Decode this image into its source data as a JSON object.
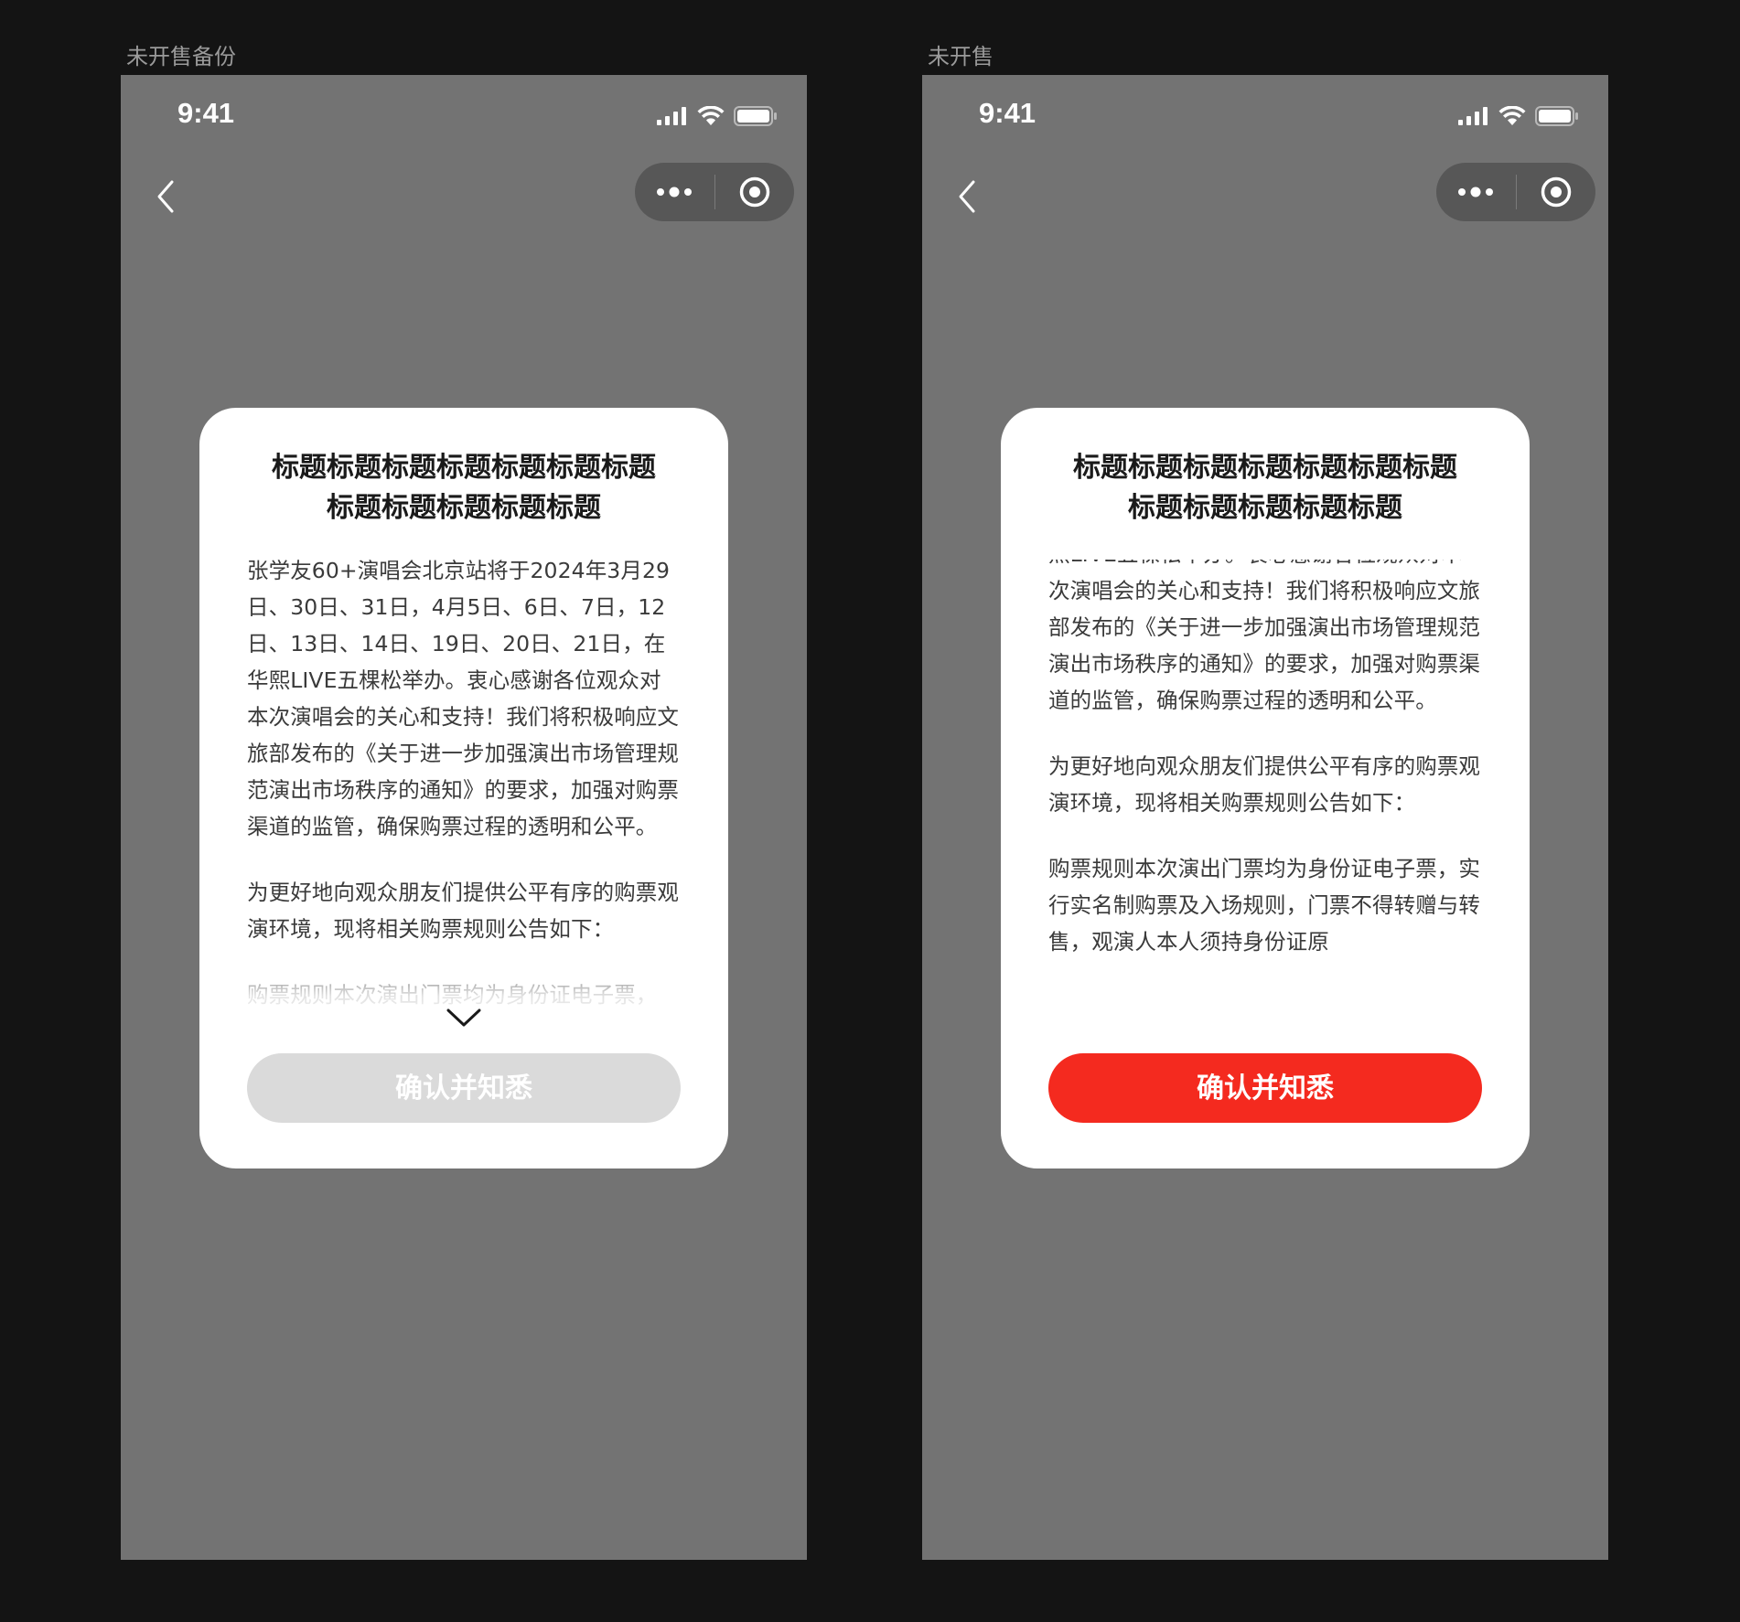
{
  "canvas_bg": "#141414",
  "frames": [
    {
      "label": "未开售备份",
      "status_time": "9:41",
      "modal": {
        "title": "标题标题标题标题标题标题标题\n标题标题标题标题标题",
        "paragraphs": [
          "张学友60+演唱会北京站将于2024年3月29日、30日、31日，4月5日、6日、7日，12日、13日、14日、19日、20日、21日，在华熙LIVE五棵松举办。衷心感谢各位观众对本次演唱会的关心和支持！我们将积极响应文旅部发布的《关于进一步加强演出市场管理规范演出市场秩序的通知》的要求，加强对购票渠道的监管，确保购票过程的透明和公平。",
          "为更好地向观众朋友们提供公平有序的购票观演环境，现将相关购票规则公告如下：",
          "购票规则本次演出门票均为身份证电子票，"
        ],
        "button_label": "确认并知悉",
        "button_state": "disabled"
      }
    },
    {
      "label": "未开售",
      "status_time": "9:41",
      "modal": {
        "title": "标题标题标题标题标题标题标题\n标题标题标题标题标题",
        "paragraphs": [
          "熙LIVE五棵松举办。衷心感谢各位观众对本次演唱会的关心和支持！我们将积极响应文旅部发布的《关于进一步加强演出市场管理规范演出市场秩序的通知》的要求，加强对购票渠道的监管，确保购票过程的透明和公平。",
          "为更好地向观众朋友们提供公平有序的购票观演环境，现将相关购票规则公告如下：",
          "购票规则本次演出门票均为身份证电子票，实行实名制购票及入场规则，门票不得转赠与转售，观演人本人须持身份证原"
        ],
        "button_label": "确认并知悉",
        "button_state": "active"
      }
    }
  ],
  "icons": {
    "back": "chevron-left-icon",
    "more": "more-dots-icon",
    "close_app": "target-circle-icon",
    "scroll_hint": "chevron-down-icon"
  },
  "colors": {
    "phone_bg": "#737373",
    "modal_bg": "#ffffff",
    "button_active": "#f42a1f",
    "button_disabled": "#dadada"
  }
}
